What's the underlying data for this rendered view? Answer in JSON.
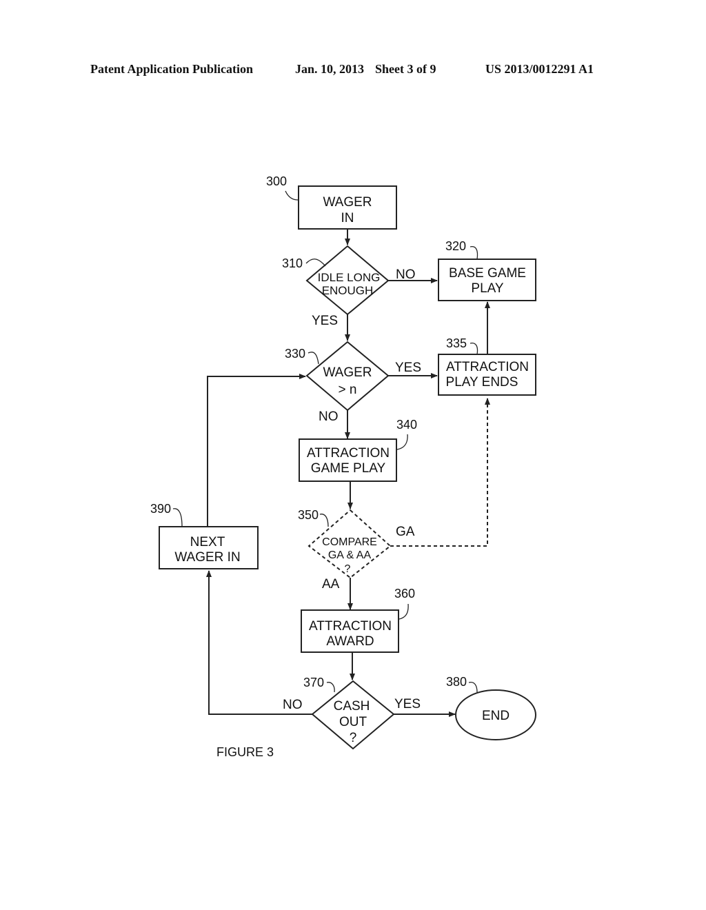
{
  "header": {
    "publication": "Patent Application Publication",
    "date": "Jan. 10, 2013",
    "sheet": "Sheet 3 of 9",
    "number": "US 2013/0012291 A1"
  },
  "figure_label": "FIGURE 3",
  "nodes": {
    "n300": {
      "ref": "300",
      "type": "process",
      "lines": [
        "WAGER",
        "IN"
      ]
    },
    "n310": {
      "ref": "310",
      "type": "decision",
      "lines": [
        "IDLE LONG",
        "ENOUGH"
      ]
    },
    "n320": {
      "ref": "320",
      "type": "process",
      "lines": [
        "BASE GAME",
        "PLAY"
      ]
    },
    "n330": {
      "ref": "330",
      "type": "decision",
      "lines": [
        "WAGER",
        "> n"
      ]
    },
    "n335": {
      "ref": "335",
      "type": "process",
      "lines": [
        "ATTRACTION",
        "PLAY ENDS"
      ]
    },
    "n340": {
      "ref": "340",
      "type": "process",
      "lines": [
        "ATTRACTION",
        "GAME PLAY"
      ]
    },
    "n350": {
      "ref": "350",
      "type": "decision-dashed",
      "lines": [
        "COMPARE",
        "GA & AA",
        "?"
      ]
    },
    "n360": {
      "ref": "360",
      "type": "process",
      "lines": [
        "ATTRACTION",
        "AWARD"
      ]
    },
    "n370": {
      "ref": "370",
      "type": "decision",
      "lines": [
        "CASH",
        "OUT",
        "?"
      ]
    },
    "n380": {
      "ref": "380",
      "type": "terminal",
      "lines": [
        "END"
      ]
    },
    "n390": {
      "ref": "390",
      "type": "process",
      "lines": [
        "NEXT",
        "WAGER IN"
      ]
    }
  },
  "edges": {
    "e310_no": "NO",
    "e310_yes": "YES",
    "e330_yes": "YES",
    "e330_no": "NO",
    "e350_ga": "GA",
    "e350_aa": "AA",
    "e370_no": "NO",
    "e370_yes": "YES"
  }
}
